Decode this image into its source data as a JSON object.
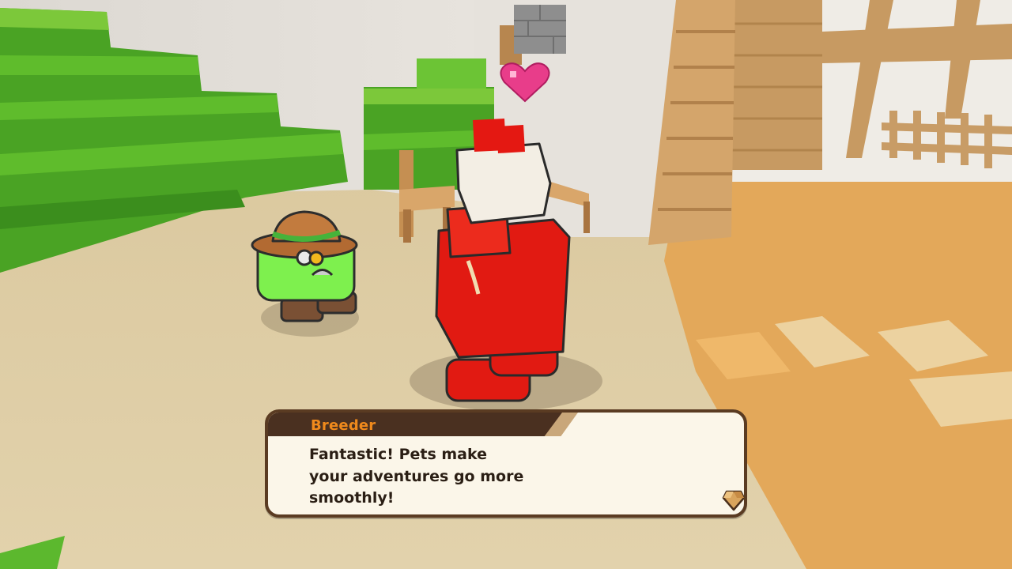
{
  "dialog": {
    "speaker": "Breeder",
    "text": "Fantastic! Pets make\nyour adventures go more\nsmoothly!"
  },
  "icons": {
    "advance": "gem-advance-icon",
    "emote": "heart-icon"
  },
  "colors": {
    "speaker_name": "#f08a1c",
    "dialog_border": "#5a3b22",
    "dialog_bg": "#fbf6e9",
    "name_tab": "#4a3020"
  }
}
